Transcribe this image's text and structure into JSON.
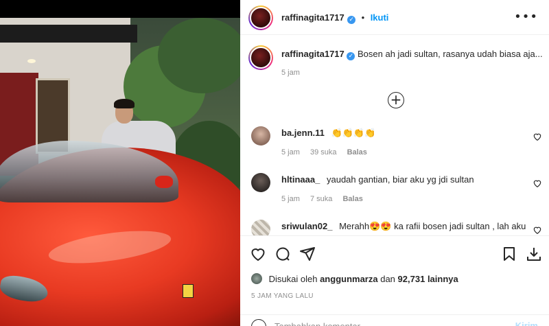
{
  "post": {
    "username": "raffinagita1717",
    "follow_label": "Ikuti",
    "separator": "•",
    "caption": "Bosen ah jadi sultan, rasanya udah biasa aja...",
    "caption_time": "5 jam"
  },
  "comments": [
    {
      "username": "ba.jenn.11",
      "text": "👏👏👏👏",
      "time": "5 jam",
      "likes": "39 suka",
      "reply": "Balas",
      "avatar_color": "#8a6a5c"
    },
    {
      "username": "hltinaaa_",
      "text": "yaudah gantian, biar aku yg jdi sultan",
      "time": "5 jam",
      "likes": "7 suka",
      "reply": "Balas",
      "avatar_color": "#2f2a28"
    },
    {
      "username": "sriwulan02_",
      "text": "Merahh😍😍 ka rafii bosen jadi sultan , lah aku",
      "time": "",
      "likes": "",
      "reply": "",
      "avatar_color": "#c7c2b8"
    }
  ],
  "likes": {
    "prefix": "Disukai oleh",
    "user": "anggunmarza",
    "middle": "dan",
    "count": "92,731",
    "suffix": "lainnya"
  },
  "post_time": "5 JAM YANG LALU",
  "add_comment": {
    "placeholder": "Tambahkan komentar...",
    "send_label": "Kirim"
  },
  "icons": {
    "more": "more-options-icon",
    "load_more": "plus-circle-icon",
    "like": "heart-icon",
    "comment": "comment-icon",
    "share": "send-icon",
    "save": "bookmark-icon",
    "download": "download-icon",
    "emoji": "emoji-icon"
  },
  "colors": {
    "accent_blue": "#0095f6",
    "verified_blue": "#3897f0",
    "muted_text": "#8e8e8e"
  }
}
